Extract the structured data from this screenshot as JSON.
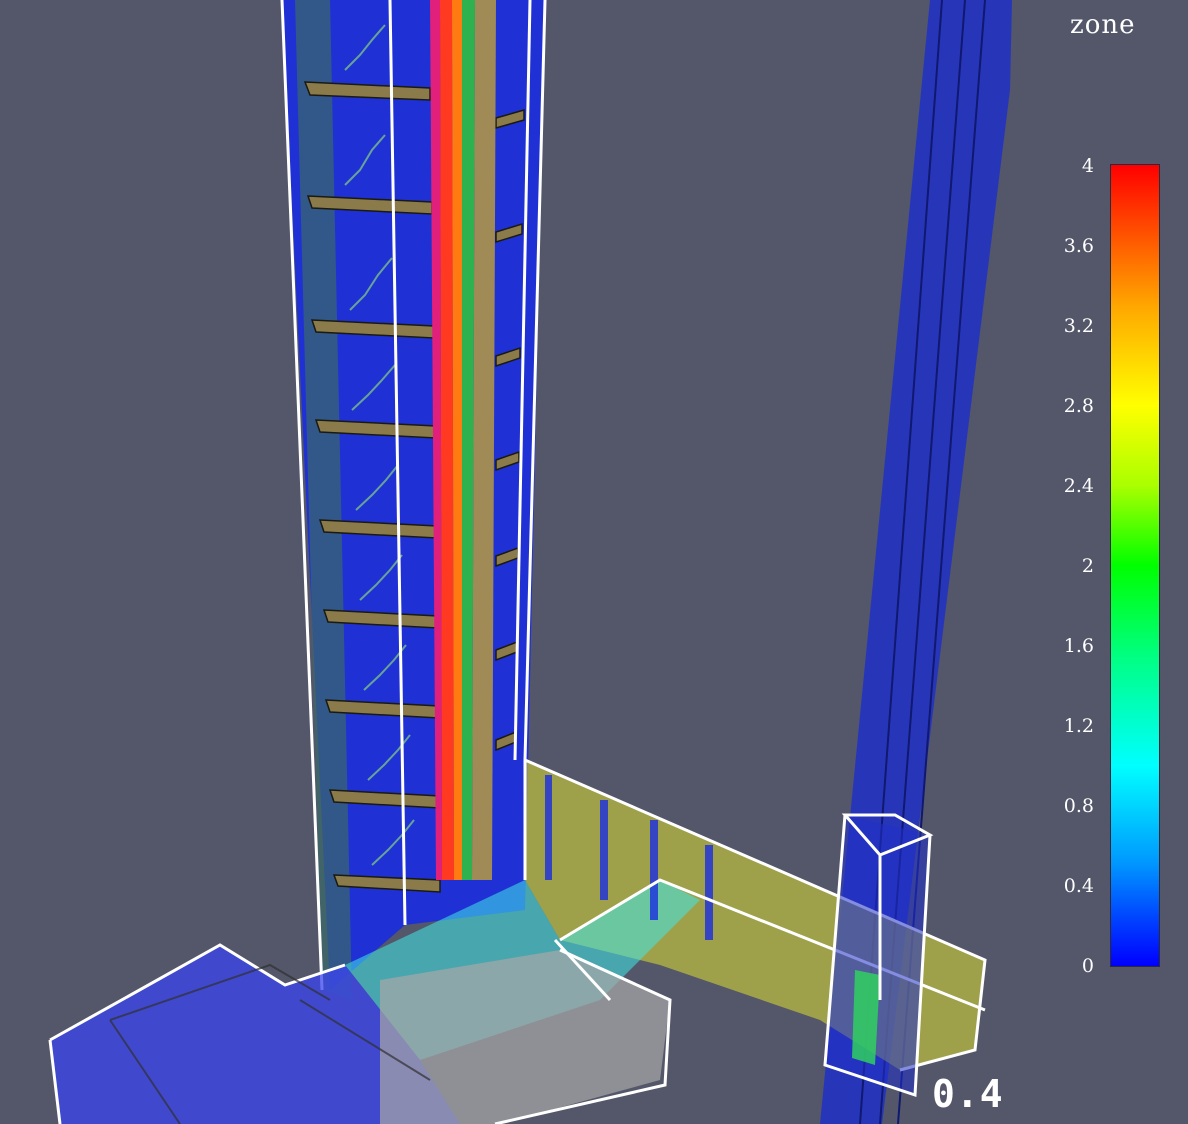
{
  "legend": {
    "title": "zone",
    "ticks": [
      "4",
      "3.6",
      "3.2",
      "2.8",
      "2.4",
      "2",
      "1.6",
      "1.2",
      "0.8",
      "0.4",
      "0"
    ],
    "range": [
      0,
      4
    ],
    "colormap": "rainbow (blue to red)"
  },
  "time_readout": "0.4",
  "colors": {
    "background": "#535769",
    "outline": "#ffffff",
    "floor": "#8b7a4a"
  }
}
